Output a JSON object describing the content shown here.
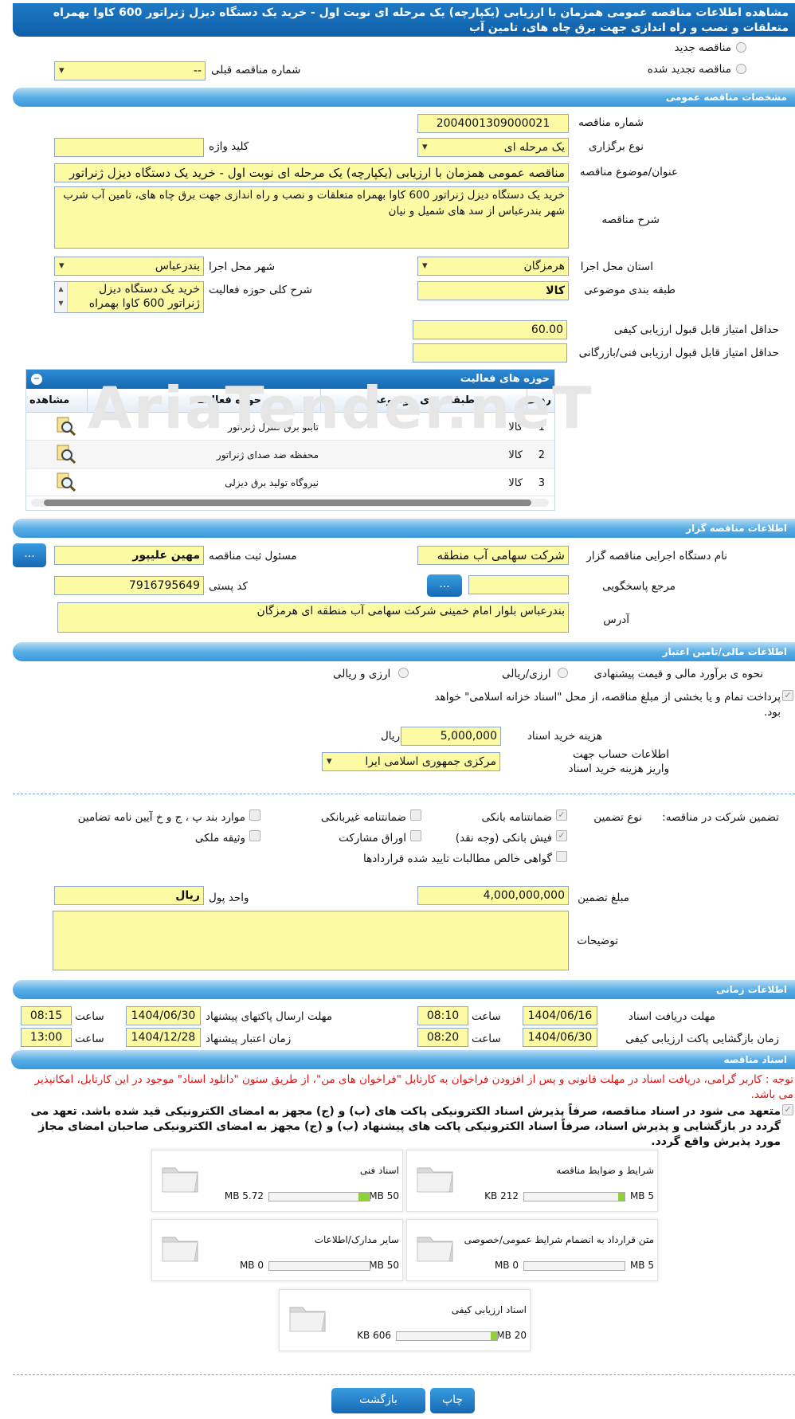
{
  "page_title": "مشاهده اطلاعات مناقصه عمومی همزمان با ارزیابی (یکپارچه) یک مرحله ای نوبت اول - خرید یک دستگاه دیزل ژنراتور 600 کاوا بهمراه متعلقات و نصب و راه اندازی جهت برق چاه های، تامین آب",
  "tender_type": {
    "new_label": "مناقصه جدید",
    "renewed_label": "مناقصه تجدید شده",
    "prev_number_label": "شماره مناقصه قبلی",
    "prev_number_value": "--"
  },
  "general": {
    "section_title": "مشخصات مناقصه عمومی",
    "number_label": "شماره مناقصه",
    "number_value": "2004001309000021",
    "holding_type_label": "نوع برگزاری",
    "holding_type_value": "یک مرحله ای",
    "keyword_label": "کلید واژه",
    "keyword_value": "",
    "subject_label": "عنوان/موضوع مناقصه",
    "subject_value": "مناقصه عمومی همزمان با ارزیابی (یکپارچه) یک مرحله ای نوبت اول - خرید یک دستگاه دیزل ژنراتور",
    "desc_label": "شرح مناقصه",
    "desc_value": "خرید یک دستگاه دیزل ژنراتور 600 کاوا بهمراه متعلقات و نصب و راه اندازی جهت برق چاه های، تامین آب شرب شهر بندرعباس از سد های شمیل و نیان",
    "province_label": "استان محل اجرا",
    "province_value": "هرمزگان",
    "city_label": "شهر محل اجرا",
    "city_value": "بندرعباس",
    "category_label": "طبقه بندی موضوعی",
    "category_value": "کالا",
    "activity_label": "شرح کلی حوزه فعالیت",
    "activity_value": "خرید یک دستگاه دیزل ژنراتور 600 کاوا بهمراه",
    "min_quality_label": "حداقل امتیاز قابل قبول ارزیابی کیفی",
    "min_quality_value": "60.00",
    "min_tech_label": "حداقل امتیاز قابل قبول ارزیابی فنی/بازرگانی",
    "min_tech_value": ""
  },
  "activities": {
    "title": "حوزه های فعالیت",
    "headers": [
      "ردیف",
      "طبقه بندی موضوعی",
      "حوزه فعالیت",
      "مشاهده"
    ],
    "rows": [
      {
        "n": "1",
        "cat": "کالا",
        "field": "تابلو برق کنترل ژنراتور"
      },
      {
        "n": "2",
        "cat": "کالا",
        "field": "محفظه ضد صدای ژنراتور"
      },
      {
        "n": "3",
        "cat": "کالا",
        "field": "نیروگاه تولید برق دیزلی"
      }
    ]
  },
  "watermark": "AriaTender.neT",
  "organizer": {
    "section_title": "اطلاعات مناقصه گزار",
    "org_label": "نام دستگاه اجرایی مناقصه گزار",
    "org_value": "شرکت سهامی  آب منطقه",
    "registrar_label": "مسئول ثبت مناقصه",
    "registrar_value": "مهین علیپور",
    "ref_label": "مرجع پاسخگویی",
    "ref_value": "",
    "postal_label": "کد پستی",
    "postal_value": "7916795649",
    "address_label": "آدرس",
    "address_value": "بندرعباس بلوار امام خمینی شرکت سهامی  آب منطقه ای هرمزگان",
    "dots": "..."
  },
  "finance": {
    "section_title": "اطلاعات مالی/تامین اعتبار",
    "estimate_label": "نحوه ی برآورد مالی و قیمت پیشنهادی",
    "opt1": "ارزی/ریالی",
    "opt2": "ارزی و ریالی",
    "treasury_text": "پرداخت تمام و یا بخشی از مبلغ مناقصه، از محل \"اسناد خزانه اسلامی\" خواهد بود.",
    "doc_fee_label": "هزینه خرید اسناد",
    "doc_fee_value": "5,000,000",
    "doc_fee_unit": "ریال",
    "account_label": "اطلاعات حساب جهت واریز هزینه خرید اسناد",
    "account_value": "مرکزی جمهوری اسلامی ایرا"
  },
  "guarantee": {
    "label": "تضمین شرکت در مناقصه:",
    "type_label": "نوع تضمین",
    "options": [
      "ضمانتنامه بانکی",
      "ضمانتنامه غیربانکی",
      "موارد بند پ ، ج و خ آیین نامه تضامین",
      "فیش بانکی (وجه نقد)",
      "اوراق مشارکت",
      "وثیقه ملکی",
      "گواهی خالص مطالبات تایید شده قراردادها"
    ],
    "amount_label": "مبلغ تضمین",
    "amount_value": "4,000,000,000",
    "currency_label": "واحد پول",
    "currency_value": "ریال",
    "notes_label": "توضیحات",
    "notes_value": ""
  },
  "timing": {
    "section_title": "اطلاعات زمانی",
    "receive_label": "مهلت دریافت اسناد",
    "receive_date": "1404/06/16",
    "receive_time": "08:10",
    "send_label": "مهلت ارسال پاکتهای پیشنهاد",
    "send_date": "1404/06/30",
    "send_time": "08:15",
    "open_label": "زمان بازگشایی پاکت ارزیابی کیفی",
    "open_date": "1404/06/30",
    "open_time": "08:20",
    "validity_label": "زمان اعتبار پیشنهاد",
    "validity_date": "1404/12/28",
    "validity_time": "13:00",
    "time_label": "ساعت"
  },
  "docs": {
    "section_title": "اسناد مناقصه",
    "notice": "توجه : کاربر گرامی، دریافت اسناد در مهلت قانونی و پس از افزودن فراخوان به کارتابل \"فراخوان های من\"، از طریق ستون \"دانلود اسناد\" موجود در این کارتابل، امکانپذیر می باشد.",
    "pledge": "متعهد می شود در اسناد مناقصه، صرفاً پذیرش اسناد الکترونیکی پاکت های (ب) و (ج) مجهز به امضای الکترونیکی قید شده باشد. تعهد می گردد در بازگشایی و پذیرش اسناد، صرفاً اسناد الکترونیکی پاکت های پیشنهاد (ب) و (ج) مجهز به امضای الکترونیکی صاحبان امضای مجاز مورد پذیرش واقع گردد.",
    "files": [
      {
        "title": "شرایط و ضوابط مناقصه",
        "size": "212 KB",
        "max": "5 MB",
        "pct": 0.04
      },
      {
        "title": "اسناد فنی",
        "size": "5.72 MB",
        "max": "50 MB",
        "pct": 0.11
      },
      {
        "title": "متن قرارداد به انضمام شرایط عمومی/خصوصی",
        "size": "0 MB",
        "max": "5 MB",
        "pct": 0
      },
      {
        "title": "سایر مدارک/اطلاعات",
        "size": "0 MB",
        "max": "50 MB",
        "pct": 0
      },
      {
        "title": "اسناد ارزیابی کیفی",
        "size": "606 KB",
        "max": "20 MB",
        "pct": 0.03
      }
    ]
  },
  "buttons": {
    "print": "چاپ",
    "back": "بازگشت"
  }
}
